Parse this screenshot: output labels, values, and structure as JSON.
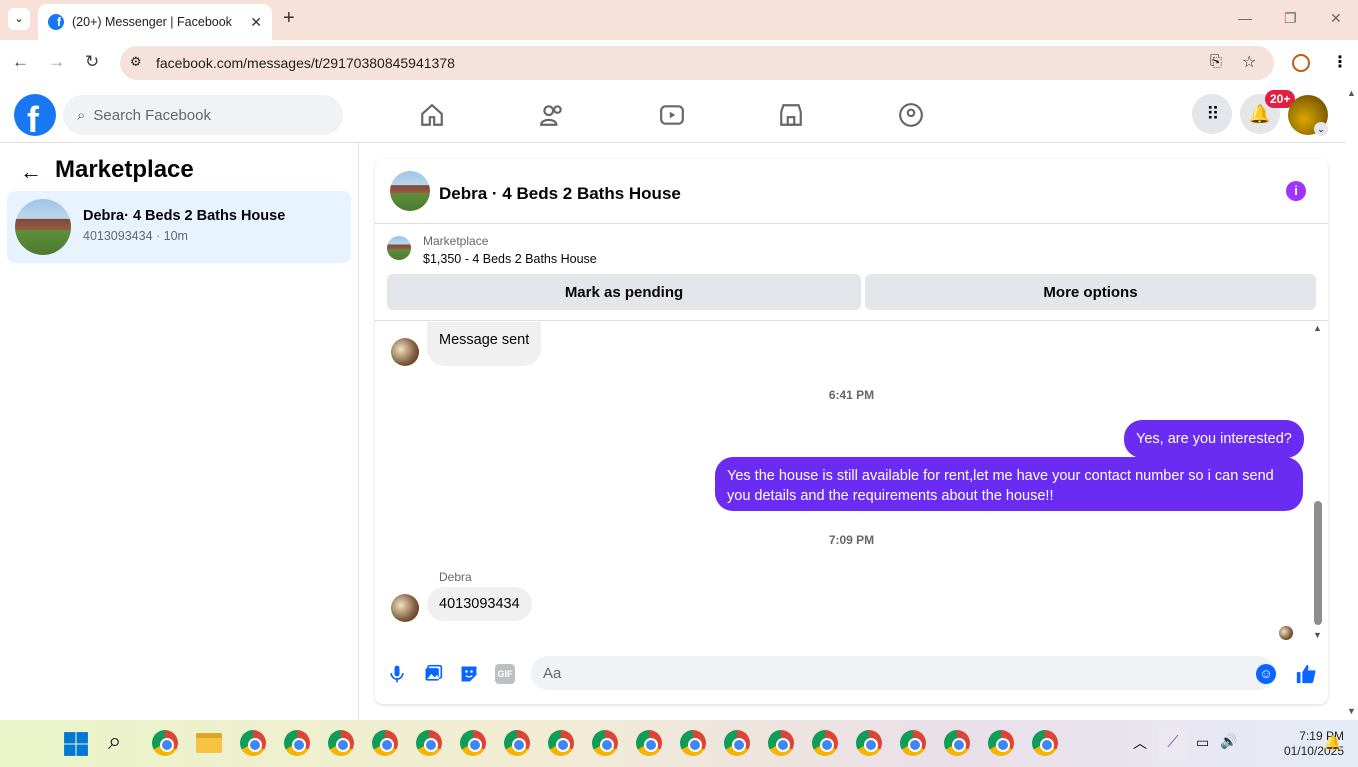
{
  "browser": {
    "tab_title": "(20+) Messenger | Facebook",
    "url": "facebook.com/messages/t/29170380845941378"
  },
  "fb_header": {
    "search_placeholder": "Search Facebook",
    "notification_badge": "20+"
  },
  "left_panel": {
    "title": "Marketplace",
    "conversations": [
      {
        "name": "Debra· 4 Beds 2 Baths House",
        "subtitle": "4013093434 · 10m"
      }
    ]
  },
  "chat": {
    "header_name": "Debra · 4 Beds 2 Baths House",
    "listing_label": "Marketplace",
    "listing_price_title": "$1,350 - 4 Beds 2 Baths House",
    "mark_pending_label": "Mark as pending",
    "more_options_label": "More options",
    "messages": {
      "m1": "Message sent",
      "ts1": "6:41 PM",
      "m2": "Yes, are you interested?",
      "m3_line1": "Yes the house is still available for rent,let me have your contact number so i can send",
      "m3_line2": "you details and the requirements about the house!!",
      "ts2": "7:09 PM",
      "sender": "Debra",
      "m4": "4013093434"
    },
    "compose_placeholder": "Aa"
  },
  "taskbar": {
    "time": "7:19 PM",
    "date": "01/10/2025"
  },
  "colors": {
    "fb_blue": "#1877f2",
    "outgoing_bubble": "#6a2cf3",
    "info_purple": "#a033ff",
    "badge_red": "#e41e3f"
  }
}
